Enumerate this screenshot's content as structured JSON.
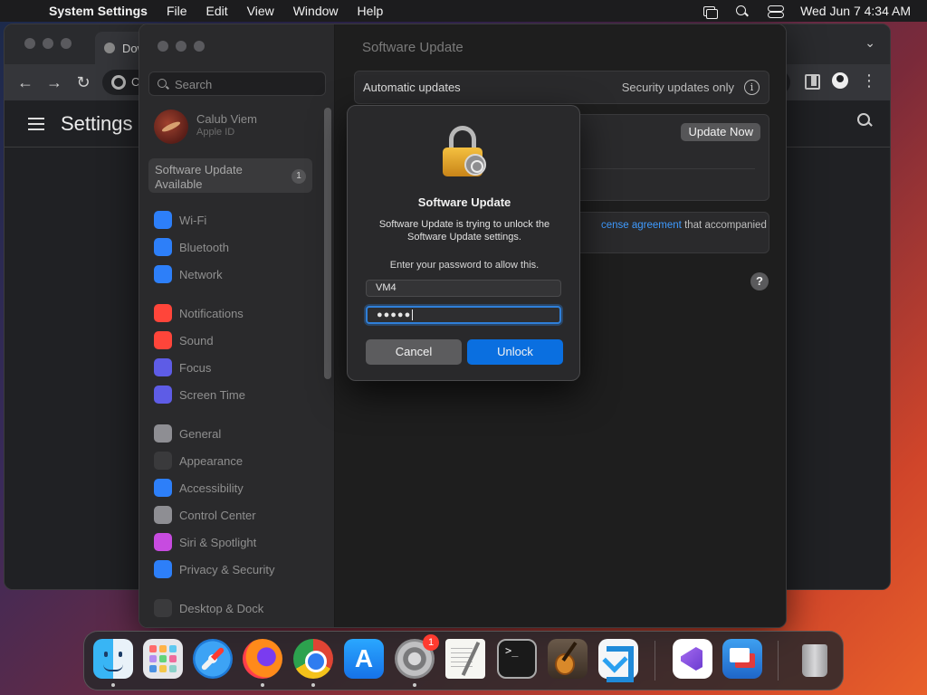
{
  "menubar": {
    "app_name": "System Settings",
    "menus": [
      "File",
      "Edit",
      "View",
      "Window",
      "Help"
    ],
    "clock": "Wed Jun 7  4:34 AM"
  },
  "browser": {
    "tab_title": "Dow",
    "omnibox_text": "C",
    "page_title": "Settings"
  },
  "settings": {
    "search_placeholder": "Search",
    "account": {
      "name": "Calub Viem",
      "subtitle": "Apple ID"
    },
    "software_update_item": {
      "label": "Software Update Available",
      "badge": "1"
    },
    "sidebar_items": [
      {
        "label": "Wi-Fi",
        "icon": "wifi-icon",
        "color": "#2d7ff9"
      },
      {
        "label": "Bluetooth",
        "icon": "bluetooth-icon",
        "color": "#2d7ff9"
      },
      {
        "label": "Network",
        "icon": "globe-icon",
        "color": "#2d7ff9"
      },
      {
        "label": "Notifications",
        "icon": "bell-icon",
        "color": "#ff453a"
      },
      {
        "label": "Sound",
        "icon": "speaker-icon",
        "color": "#ff453a"
      },
      {
        "label": "Focus",
        "icon": "moon-icon",
        "color": "#5e5ce6"
      },
      {
        "label": "Screen Time",
        "icon": "hourglass-icon",
        "color": "#5e5ce6"
      },
      {
        "label": "General",
        "icon": "gear-icon",
        "color": "#8e8e93"
      },
      {
        "label": "Appearance",
        "icon": "appearance-icon",
        "color": "#3a3a3c"
      },
      {
        "label": "Accessibility",
        "icon": "accessibility-icon",
        "color": "#2d7ff9"
      },
      {
        "label": "Control Center",
        "icon": "control-center-icon",
        "color": "#8e8e93"
      },
      {
        "label": "Siri & Spotlight",
        "icon": "siri-icon",
        "color": "#c74be0"
      },
      {
        "label": "Privacy & Security",
        "icon": "hand-icon",
        "color": "#2d7ff9"
      },
      {
        "label": "Desktop & Dock",
        "icon": "desktop-icon",
        "color": "#3a3a3c"
      }
    ],
    "main": {
      "title": "Software Update",
      "automatic_updates_label": "Automatic updates",
      "automatic_updates_value": "Security updates only",
      "update_now_label": "Update Now",
      "license_link": "cense agreement",
      "license_rest": " that accompanied",
      "help": "?"
    }
  },
  "dialog": {
    "title": "Software Update",
    "message": "Software Update is trying to unlock the Software Update settings.",
    "prompt": "Enter your password to allow this.",
    "username": "VM4",
    "password_mask": "●●●●●",
    "cancel_label": "Cancel",
    "unlock_label": "Unlock"
  },
  "dock": {
    "apps": [
      "Finder",
      "Launchpad",
      "Safari",
      "Firefox",
      "Google Chrome",
      "App Store",
      "System Settings",
      "TextEdit",
      "Terminal",
      "GarageBand",
      "Visual Studio Code",
      "Visual Studio",
      "Microsoft Remote Desktop",
      "Trash"
    ],
    "settings_badge": "1"
  }
}
